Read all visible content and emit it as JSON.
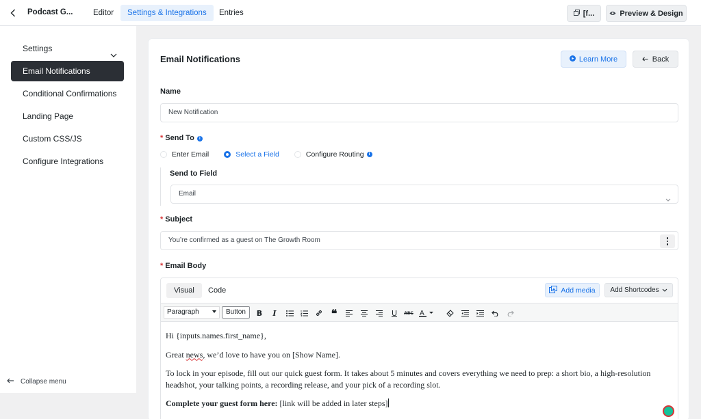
{
  "topbar": {
    "form_title": "Podcast G...",
    "tabs": [
      {
        "label": "Editor",
        "active": false
      },
      {
        "label": "Settings & Integrations",
        "active": true
      },
      {
        "label": "Entries",
        "active": false
      }
    ],
    "shortcode_label": "[f...",
    "preview_label": "Preview & Design"
  },
  "sidebar": {
    "items": [
      {
        "label": "Settings",
        "active": false,
        "expandable": true
      },
      {
        "label": "Email Notifications",
        "active": true
      },
      {
        "label": "Conditional Confirmations",
        "active": false
      },
      {
        "label": "Landing Page",
        "active": false
      },
      {
        "label": "Custom CSS/JS",
        "active": false
      },
      {
        "label": "Configure Integrations",
        "active": false
      }
    ],
    "collapse_label": "Collapse menu"
  },
  "card": {
    "title": "Email Notifications",
    "learn_more_label": "Learn More",
    "back_label": "Back",
    "name": {
      "label": "Name",
      "value": "New Notification"
    },
    "send_to": {
      "label": "Send To",
      "options": [
        {
          "label": "Enter Email",
          "selected": false
        },
        {
          "label": "Select a Field",
          "selected": true
        },
        {
          "label": "Configure Routing",
          "selected": false,
          "info": true
        }
      ],
      "field_label": "Send to Field",
      "field_value": "Email"
    },
    "subject": {
      "label": "Subject",
      "value": "You’re confirmed as a guest on The Growth Room"
    },
    "email_body": {
      "label": "Email Body",
      "tabs": [
        "Visual",
        "Code"
      ],
      "add_media_label": "Add media",
      "add_shortcodes_label": "Add Shortcodes",
      "format_select": "Paragraph",
      "toolbar_button": "Button",
      "paragraphs": {
        "p1": "Hi {inputs.names.first_name},",
        "p2_pre": "Great ",
        "p2_spell": "news,",
        "p2_post": " we’d love to have you on [Show Name].",
        "p3": "To lock in your episode, fill out our quick guest form. It takes about 5 minutes and covers everything we need to prep: a short bio, a high-resolution headshot, your talking points, a recording release, and your pick of a recording slot.",
        "p4_bold": "Complete your guest form here:",
        "p4_rest": " [link will be added in later steps]"
      }
    }
  },
  "colors": {
    "accent": "#1a73e8",
    "sidebar_active_bg": "#2b2f35",
    "required": "#d63638",
    "page_bg": "#f0f0f1"
  },
  "icons": [
    "chevron-left-icon",
    "copy-icon",
    "eye-icon",
    "chevron-down-icon",
    "arrow-left-icon",
    "play-circle-icon",
    "info-icon",
    "add-media-icon"
  ]
}
